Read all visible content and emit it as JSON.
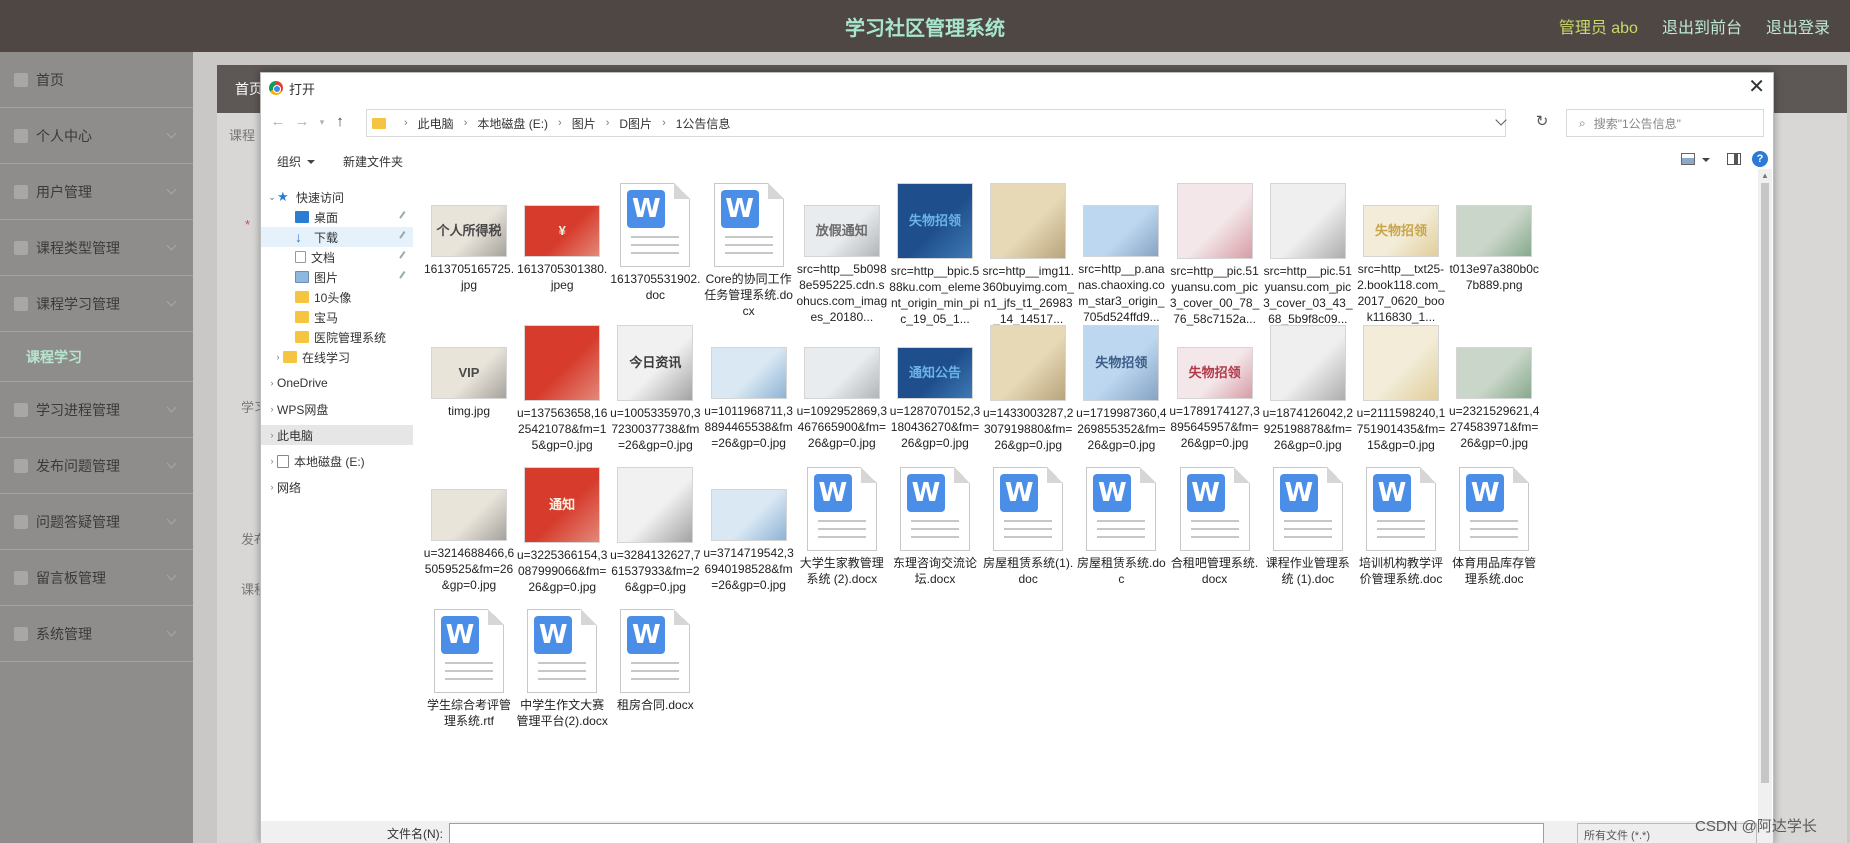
{
  "app": {
    "title": "学习社区管理系统",
    "user": "管理员 abo",
    "to_front": "退出到前台",
    "logout": "退出登录"
  },
  "sidebar": {
    "items": [
      {
        "label": "首页"
      },
      {
        "label": "个人中心"
      },
      {
        "label": "用户管理"
      },
      {
        "label": "课程类型管理"
      },
      {
        "label": "课程学习管理"
      },
      {
        "label": "课程学习",
        "sub": true
      },
      {
        "label": "学习进程管理"
      },
      {
        "label": "发布问题管理"
      },
      {
        "label": "问题答疑管理"
      },
      {
        "label": "留言板管理"
      },
      {
        "label": "系统管理"
      }
    ]
  },
  "breadcrumb": {
    "home": "首页"
  },
  "form_fragments": {
    "f1": "课程",
    "f2": "*",
    "f3": "学习",
    "f4": "发布",
    "f5": "课程"
  },
  "dialog": {
    "title": "打开",
    "close": "✕",
    "path": [
      "此电脑",
      "本地磁盘 (E:)",
      "图片",
      "D图片",
      "1公告信息"
    ],
    "search_placeholder": "搜索\"1公告信息\"",
    "organize": "组织",
    "new_folder": "新建文件夹",
    "help": "?",
    "filename_label": "文件名(N):",
    "filetype_label": "所有文件 (*.*)",
    "nav": [
      {
        "label": "快速访问",
        "icon": "star-icon"
      },
      {
        "label": "桌面",
        "icon": "desktop-icon",
        "pinned": true
      },
      {
        "label": "下载",
        "icon": "download-icon",
        "pinned": true
      },
      {
        "label": "文档",
        "icon": "document-icon",
        "pinned": true
      },
      {
        "label": "图片",
        "icon": "pictures-icon",
        "pinned": true
      },
      {
        "label": "10头像",
        "icon": "folder-icon"
      },
      {
        "label": "宝马",
        "icon": "folder-icon"
      },
      {
        "label": "医院管理系统",
        "icon": "folder-icon"
      },
      {
        "label": "在线学习",
        "icon": "folder-icon"
      },
      {
        "label": "OneDrive",
        "icon": "onedrive-icon"
      },
      {
        "label": "WPS网盘",
        "icon": "cloud-icon"
      },
      {
        "label": "此电脑",
        "icon": "computer-icon"
      },
      {
        "label": "本地磁盘 (E:)",
        "icon": "disk-icon"
      },
      {
        "label": "网络",
        "icon": "network-icon"
      }
    ],
    "files": [
      {
        "name": "1613705165725.jpg",
        "kind": "img",
        "thumb": "个人所得税"
      },
      {
        "name": "1613705301380.jpeg",
        "kind": "img",
        "thumb": "¥"
      },
      {
        "name": "1613705531902.doc",
        "kind": "doc"
      },
      {
        "name": "Core的协同工作任务管理系统.docx",
        "kind": "doc"
      },
      {
        "name": "src=http__5b0988e595225.cdn.sohucs.com_images_20180...",
        "kind": "img",
        "thumb": "放假通知"
      },
      {
        "name": "src=http__bpic.588ku.com_element_origin_min_pic_19_05_1...",
        "kind": "img",
        "thumb": "失物招领"
      },
      {
        "name": "src=http__img11.360buyimg.com_n1_jfs_t1_26983_14_14517...",
        "kind": "img",
        "thumb": ""
      },
      {
        "name": "src=http__p.ananas.chaoxing.com_star3_origin_705d524ffd9...",
        "kind": "img",
        "thumb": ""
      },
      {
        "name": "src=http__pic.51yuansu.com_pic3_cover_00_78_76_58c7152a...",
        "kind": "img",
        "thumb": ""
      },
      {
        "name": "src=http__pic.51yuansu.com_pic3_cover_03_43_68_5b9f8c09...",
        "kind": "img",
        "thumb": ""
      },
      {
        "name": "src=http__txt25-2.book118.com_2017_0620_book116830_1...",
        "kind": "img",
        "thumb": "失物招领"
      },
      {
        "name": "t013e97a380b0c7b889.png",
        "kind": "img",
        "thumb": ""
      },
      {
        "name": "timg.jpg",
        "kind": "img",
        "thumb": "VIP"
      },
      {
        "name": "u=137563658,1625421078&fm=15&gp=0.jpg",
        "kind": "img",
        "thumb": ""
      },
      {
        "name": "u=1005335970,37230037738&fm=26&gp=0.jpg",
        "kind": "img",
        "thumb": "今日资讯"
      },
      {
        "name": "u=1011968711,38894465538&fm=26&gp=0.jpg",
        "kind": "img",
        "thumb": ""
      },
      {
        "name": "u=1092952869,3467665900&fm=26&gp=0.jpg",
        "kind": "img",
        "thumb": ""
      },
      {
        "name": "u=1287070152,3180436270&fm=26&gp=0.jpg",
        "kind": "img",
        "thumb": "通知公告"
      },
      {
        "name": "u=1433003287,2307919880&fm=26&gp=0.jpg",
        "kind": "img",
        "thumb": ""
      },
      {
        "name": "u=1719987360,4269855352&fm=26&gp=0.jpg",
        "kind": "img",
        "thumb": "失物招领"
      },
      {
        "name": "u=1789174127,3895645957&fm=26&gp=0.jpg",
        "kind": "img",
        "thumb": "失物招领"
      },
      {
        "name": "u=1874126042,2925198878&fm=26&gp=0.jpg",
        "kind": "img",
        "thumb": ""
      },
      {
        "name": "u=2111598240,1751901435&fm=15&gp=0.jpg",
        "kind": "img",
        "thumb": ""
      },
      {
        "name": "u=2321529621,4274583971&fm=26&gp=0.jpg",
        "kind": "img",
        "thumb": ""
      },
      {
        "name": "u=3214688466,65059525&fm=26&gp=0.jpg",
        "kind": "img",
        "thumb": ""
      },
      {
        "name": "u=3225366154,3087999066&fm=26&gp=0.jpg",
        "kind": "img",
        "thumb": "通知"
      },
      {
        "name": "u=3284132627,761537933&fm=26&gp=0.jpg",
        "kind": "img",
        "thumb": ""
      },
      {
        "name": "u=3714719542,36940198528&fm=26&gp=0.jpg",
        "kind": "img",
        "thumb": ""
      },
      {
        "name": "大学生家教管理系统 (2).docx",
        "kind": "doc"
      },
      {
        "name": "东理咨询交流论坛.docx",
        "kind": "doc"
      },
      {
        "name": "房屋租赁系统(1).doc",
        "kind": "doc"
      },
      {
        "name": "房屋租赁系统.doc",
        "kind": "doc"
      },
      {
        "name": "合租吧管理系统.docx",
        "kind": "doc"
      },
      {
        "name": "课程作业管理系统 (1).doc",
        "kind": "doc"
      },
      {
        "name": "培训机构教学评价管理系统.doc",
        "kind": "doc"
      },
      {
        "name": "体育用品库存管理系统.doc",
        "kind": "doc"
      },
      {
        "name": "学生综合考评管理系统.rtf",
        "kind": "doc"
      },
      {
        "name": "中学生作文大赛管理平台(2).docx",
        "kind": "doc"
      },
      {
        "name": "租房合同.docx",
        "kind": "doc"
      }
    ]
  },
  "watermark": "CSDN @阿达学长",
  "colors": {
    "title": "#a8e6cf",
    "user_link": "#c9d96a",
    "word_badge": "#4a8ee8",
    "sidebar": "#8e8d8c",
    "topbar": "#4f4744"
  }
}
